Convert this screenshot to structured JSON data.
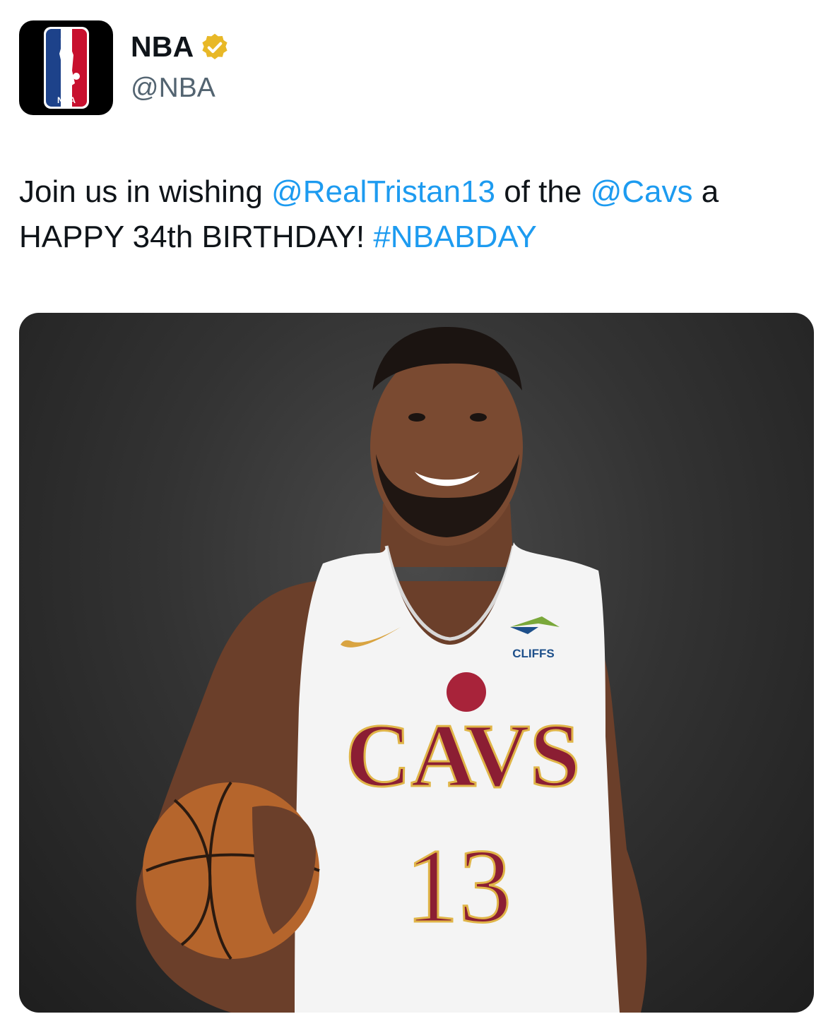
{
  "account": {
    "display_name": "NBA",
    "handle": "@NBA",
    "avatar_logo_text": "NBA",
    "verified_color": "#e8b827"
  },
  "tweet": {
    "text_1": "Join us in wishing ",
    "mention_1": "@RealTristan13",
    "text_2": " of the ",
    "mention_2": "@Cavs",
    "text_3": " a HAPPY 34th BIRTHDAY! ",
    "hashtag": "#NBABDAY",
    "link_color": "#1d9bf0"
  },
  "media": {
    "jersey_sponsor": "CLIFFS",
    "jersey_team": "CAVS",
    "jersey_number": "13"
  }
}
